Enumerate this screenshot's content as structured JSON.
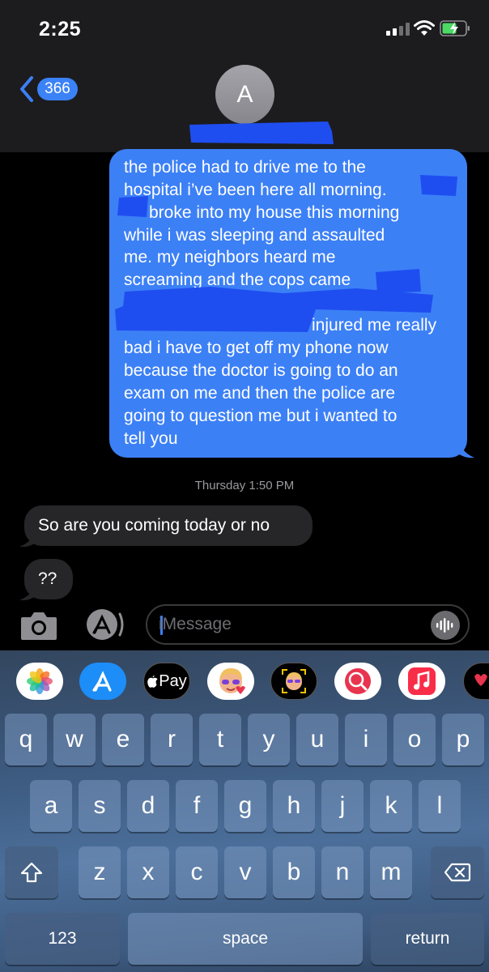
{
  "status_bar": {
    "time": "2:25"
  },
  "nav": {
    "back_count": "366",
    "avatar_initial": "A"
  },
  "messages": {
    "sent": {
      "lines": [
        "the police had to drive me to the",
        "hospital i’ve been here all morning.",
        "broke into my house this morning",
        "while i was sleeping and assaulted",
        "me.  my neighbors heard me",
        "screaming and the cops came",
        "injured me really",
        "bad i have to get off my phone now",
        "because the doctor is going to do an",
        "exam on me and then the police are",
        "going to question me but i wanted to",
        "tell you"
      ]
    },
    "timestamp": "Thursday 1:50 PM",
    "received": [
      {
        "text": "So are you coming today or no"
      },
      {
        "text": "??"
      }
    ]
  },
  "compose": {
    "placeholder": "iMessage"
  },
  "app_strip": [
    "photos-icon",
    "app-store-icon",
    "apple-pay-icon",
    "memoji-icon",
    "animoji-icon",
    "image-search-icon",
    "music-icon",
    "digital-touch-icon"
  ],
  "app_strip_labels": {
    "apple_pay": "Pay"
  },
  "keyboard": {
    "row1": [
      "q",
      "w",
      "e",
      "r",
      "t",
      "y",
      "u",
      "i",
      "o",
      "p"
    ],
    "row2": [
      "a",
      "s",
      "d",
      "f",
      "g",
      "h",
      "j",
      "k",
      "l"
    ],
    "row3": [
      "z",
      "x",
      "c",
      "v",
      "b",
      "n",
      "m"
    ],
    "numbers_label": "123",
    "space_label": "space",
    "return_label": "return"
  },
  "colors": {
    "sent_bubble": "#3c80f6",
    "received_bubble": "#262628",
    "redaction": "#1f4ef0",
    "background": "#000000"
  }
}
